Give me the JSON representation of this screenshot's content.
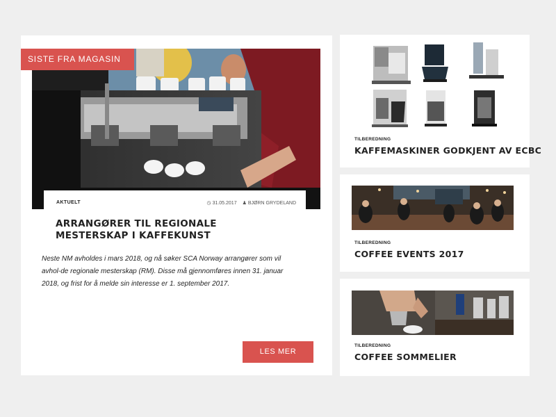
{
  "main": {
    "badge": "SISTE FRA MAGASIN",
    "category": "AKTUELT",
    "date": "31.05.2017",
    "author": "BJØRN GRYDELAND",
    "title": "ARRANGØRER TIL REGIONALE MESTERSKAP I KAFFEKUNST",
    "excerpt": "Neste NM avholdes i mars 2018, og nå søker SCA Norway arrangører som vil avhol-de regionale mesterskap (RM). Disse må gjennomføres innen 31. januar 2018, og frist for å melde sin interesse er 1. september 2017.",
    "read_more": "LES MER"
  },
  "side": [
    {
      "category": "TILBEREDNING",
      "title": "KAFFEMASKINER GODKJENT AV ECBC"
    },
    {
      "category": "TILBEREDNING",
      "title": "COFFEE EVENTS 2017"
    },
    {
      "category": "TILBEREDNING",
      "title": "COFFEE SOMMELIER"
    }
  ],
  "icons": {
    "date_icon": "clock-icon",
    "author_icon": "user-icon"
  },
  "colors": {
    "accent": "#d9534f",
    "background": "#efefef",
    "card": "#ffffff"
  }
}
